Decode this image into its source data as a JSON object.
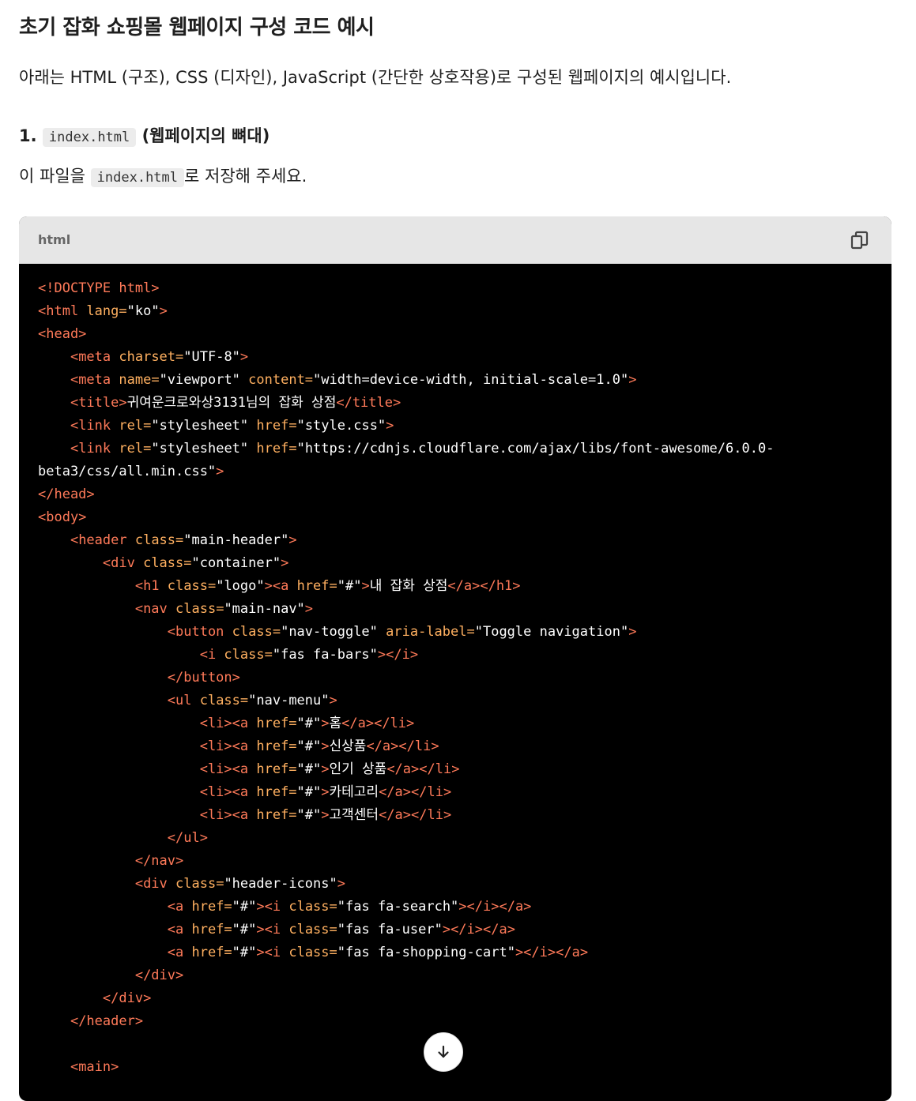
{
  "heading": "초기 잡화 쇼핑몰 웹페이지 구성 코드 예시",
  "intro": "아래는 HTML (구조), CSS (디자인), JavaScript (간단한 상호작용)로 구성된 웹페이지의 예시입니다.",
  "section": {
    "number": "1.",
    "filename": "index.html",
    "suffix": "(웹페이지의 뼈대)"
  },
  "note": {
    "prefix": "이 파일을",
    "filename": "index.html",
    "suffix": "로 저장해 주세요."
  },
  "code_block": {
    "language": "html",
    "copy_icon": "copy-icon",
    "lines": [
      [
        [
          "t",
          "<!DOCTYPE html>"
        ]
      ],
      [
        [
          "t",
          "<html "
        ],
        [
          "a",
          "lang="
        ],
        [
          "s",
          "\"ko\""
        ],
        [
          "t",
          ">"
        ]
      ],
      [
        [
          "t",
          "<head>"
        ]
      ],
      [
        [
          "x",
          "    "
        ],
        [
          "t",
          "<meta "
        ],
        [
          "a",
          "charset="
        ],
        [
          "s",
          "\"UTF-8\""
        ],
        [
          "t",
          ">"
        ]
      ],
      [
        [
          "x",
          "    "
        ],
        [
          "t",
          "<meta "
        ],
        [
          "a",
          "name="
        ],
        [
          "s",
          "\"viewport\""
        ],
        [
          "a",
          " content="
        ],
        [
          "s",
          "\"width=device-width, initial-scale=1.0\""
        ],
        [
          "t",
          ">"
        ]
      ],
      [
        [
          "x",
          "    "
        ],
        [
          "t",
          "<title>"
        ],
        [
          "x",
          "귀여운크로와상3131님의 잡화 상점"
        ],
        [
          "t",
          "</title>"
        ]
      ],
      [
        [
          "x",
          "    "
        ],
        [
          "t",
          "<link "
        ],
        [
          "a",
          "rel="
        ],
        [
          "s",
          "\"stylesheet\""
        ],
        [
          "a",
          " href="
        ],
        [
          "s",
          "\"style.css\""
        ],
        [
          "t",
          ">"
        ]
      ],
      [
        [
          "x",
          "    "
        ],
        [
          "t",
          "<link "
        ],
        [
          "a",
          "rel="
        ],
        [
          "s",
          "\"stylesheet\""
        ],
        [
          "a",
          " href="
        ],
        [
          "s",
          "\"https://cdnjs.cloudflare.com/ajax/libs/font-awesome/6.0.0-"
        ]
      ],
      [
        [
          "s",
          "beta3/css/all.min.css\""
        ],
        [
          "t",
          ">"
        ]
      ],
      [
        [
          "t",
          "</head>"
        ]
      ],
      [
        [
          "t",
          "<body>"
        ]
      ],
      [
        [
          "x",
          "    "
        ],
        [
          "t",
          "<header "
        ],
        [
          "a",
          "class="
        ],
        [
          "s",
          "\"main-header\""
        ],
        [
          "t",
          ">"
        ]
      ],
      [
        [
          "x",
          "        "
        ],
        [
          "t",
          "<div "
        ],
        [
          "a",
          "class="
        ],
        [
          "s",
          "\"container\""
        ],
        [
          "t",
          ">"
        ]
      ],
      [
        [
          "x",
          "            "
        ],
        [
          "t",
          "<h1 "
        ],
        [
          "a",
          "class="
        ],
        [
          "s",
          "\"logo\""
        ],
        [
          "t",
          "><a "
        ],
        [
          "a",
          "href="
        ],
        [
          "s",
          "\"#\""
        ],
        [
          "t",
          ">"
        ],
        [
          "x",
          "내 잡화 상점"
        ],
        [
          "t",
          "</a></h1>"
        ]
      ],
      [
        [
          "x",
          "            "
        ],
        [
          "t",
          "<nav "
        ],
        [
          "a",
          "class="
        ],
        [
          "s",
          "\"main-nav\""
        ],
        [
          "t",
          ">"
        ]
      ],
      [
        [
          "x",
          "                "
        ],
        [
          "t",
          "<button "
        ],
        [
          "a",
          "class="
        ],
        [
          "s",
          "\"nav-toggle\""
        ],
        [
          "a",
          " aria-label="
        ],
        [
          "s",
          "\"Toggle navigation\""
        ],
        [
          "t",
          ">"
        ]
      ],
      [
        [
          "x",
          "                    "
        ],
        [
          "t",
          "<i "
        ],
        [
          "a",
          "class="
        ],
        [
          "s",
          "\"fas fa-bars\""
        ],
        [
          "t",
          "></i>"
        ]
      ],
      [
        [
          "x",
          "                "
        ],
        [
          "t",
          "</button>"
        ]
      ],
      [
        [
          "x",
          "                "
        ],
        [
          "t",
          "<ul "
        ],
        [
          "a",
          "class="
        ],
        [
          "s",
          "\"nav-menu\""
        ],
        [
          "t",
          ">"
        ]
      ],
      [
        [
          "x",
          "                    "
        ],
        [
          "t",
          "<li><a "
        ],
        [
          "a",
          "href="
        ],
        [
          "s",
          "\"#\""
        ],
        [
          "t",
          ">"
        ],
        [
          "x",
          "홈"
        ],
        [
          "t",
          "</a></li>"
        ]
      ],
      [
        [
          "x",
          "                    "
        ],
        [
          "t",
          "<li><a "
        ],
        [
          "a",
          "href="
        ],
        [
          "s",
          "\"#\""
        ],
        [
          "t",
          ">"
        ],
        [
          "x",
          "신상품"
        ],
        [
          "t",
          "</a></li>"
        ]
      ],
      [
        [
          "x",
          "                    "
        ],
        [
          "t",
          "<li><a "
        ],
        [
          "a",
          "href="
        ],
        [
          "s",
          "\"#\""
        ],
        [
          "t",
          ">"
        ],
        [
          "x",
          "인기 상품"
        ],
        [
          "t",
          "</a></li>"
        ]
      ],
      [
        [
          "x",
          "                    "
        ],
        [
          "t",
          "<li><a "
        ],
        [
          "a",
          "href="
        ],
        [
          "s",
          "\"#\""
        ],
        [
          "t",
          ">"
        ],
        [
          "x",
          "카테고리"
        ],
        [
          "t",
          "</a></li>"
        ]
      ],
      [
        [
          "x",
          "                    "
        ],
        [
          "t",
          "<li><a "
        ],
        [
          "a",
          "href="
        ],
        [
          "s",
          "\"#\""
        ],
        [
          "t",
          ">"
        ],
        [
          "x",
          "고객센터"
        ],
        [
          "t",
          "</a></li>"
        ]
      ],
      [
        [
          "x",
          "                "
        ],
        [
          "t",
          "</ul>"
        ]
      ],
      [
        [
          "x",
          "            "
        ],
        [
          "t",
          "</nav>"
        ]
      ],
      [
        [
          "x",
          "            "
        ],
        [
          "t",
          "<div "
        ],
        [
          "a",
          "class="
        ],
        [
          "s",
          "\"header-icons\""
        ],
        [
          "t",
          ">"
        ]
      ],
      [
        [
          "x",
          "                "
        ],
        [
          "t",
          "<a "
        ],
        [
          "a",
          "href="
        ],
        [
          "s",
          "\"#\""
        ],
        [
          "t",
          "><i "
        ],
        [
          "a",
          "class="
        ],
        [
          "s",
          "\"fas fa-search\""
        ],
        [
          "t",
          "></i></a>"
        ]
      ],
      [
        [
          "x",
          "                "
        ],
        [
          "t",
          "<a "
        ],
        [
          "a",
          "href="
        ],
        [
          "s",
          "\"#\""
        ],
        [
          "t",
          "><i "
        ],
        [
          "a",
          "class="
        ],
        [
          "s",
          "\"fas fa-user\""
        ],
        [
          "t",
          "></i></a>"
        ]
      ],
      [
        [
          "x",
          "                "
        ],
        [
          "t",
          "<a "
        ],
        [
          "a",
          "href="
        ],
        [
          "s",
          "\"#\""
        ],
        [
          "t",
          "><i "
        ],
        [
          "a",
          "class="
        ],
        [
          "s",
          "\"fas fa-shopping-cart\""
        ],
        [
          "t",
          "></i></a>"
        ]
      ],
      [
        [
          "x",
          "            "
        ],
        [
          "t",
          "</div>"
        ]
      ],
      [
        [
          "x",
          "        "
        ],
        [
          "t",
          "</div>"
        ]
      ],
      [
        [
          "x",
          "    "
        ],
        [
          "t",
          "</header>"
        ]
      ],
      [
        [
          "x",
          ""
        ]
      ],
      [
        [
          "x",
          "    "
        ],
        [
          "t",
          "<main>"
        ]
      ]
    ]
  },
  "scroll_button": {
    "icon": "arrow-down-icon"
  },
  "colors": {
    "tag": "#ff7a59",
    "attr": "#ffb060",
    "string": "#ffffff",
    "text": "#ffffff",
    "code_bg": "#000000",
    "header_bg": "#e6e6e6"
  }
}
